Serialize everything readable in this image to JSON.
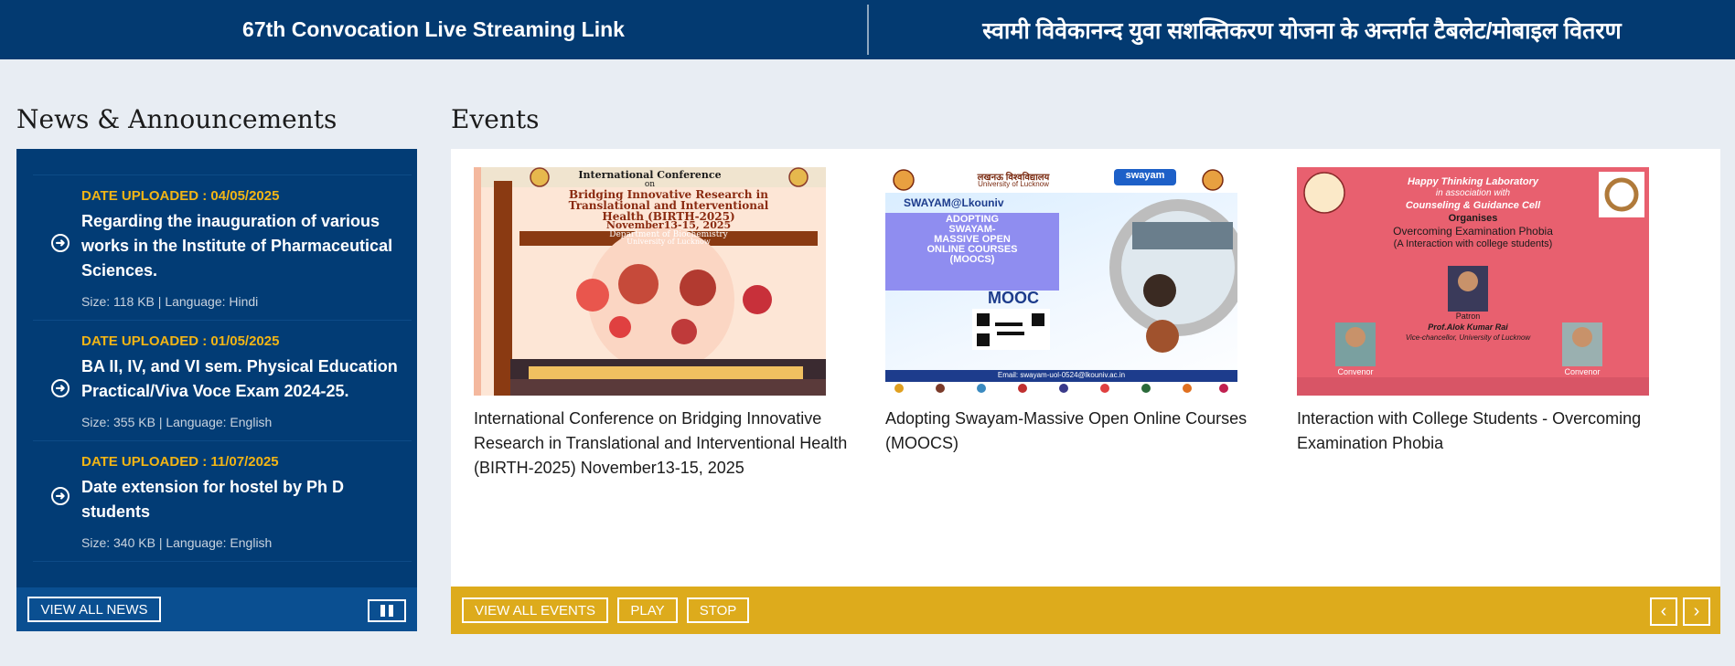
{
  "topbar": {
    "left_link": "67th Convocation Live Streaming Link",
    "right_link": "स्वामी विवेकानन्द युवा सशक्तिकरण योजना के अन्तर्गत टैबलेट/मोबाइल वितरण"
  },
  "news": {
    "heading": "News & Announcements",
    "items": [
      {
        "date": "DATE UPLOADED : 04/05/2025",
        "title": "Regarding the inauguration of various works in the Institute of Pharmaceutical Sciences.",
        "meta": "Size: 118 KB | Language: Hindi"
      },
      {
        "date": "DATE UPLOADED : 01/05/2025",
        "title": "BA II, IV, and VI sem. Physical Education Practical/Viva Voce Exam 2024-25.",
        "meta": "Size: 355 KB | Language: English"
      },
      {
        "date": "DATE UPLOADED : 11/07/2025",
        "title": "Date extension for hostel by Ph D students",
        "meta": "Size: 340 KB | Language: English"
      }
    ],
    "view_all": "VIEW ALL NEWS",
    "item_icon": "circle-arrow-right-icon",
    "pause_icon": "pause-icon"
  },
  "events": {
    "heading": "Events",
    "cards": [
      {
        "title": "International Conference on Bridging Innovative Research in Translational and Interventional Health (BIRTH-2025) November13-15, 2025",
        "poster": {
          "header": "International Conference",
          "on": "on",
          "line1": "Bridging Innovative Research in",
          "line2": "Translational and Interventional",
          "line3": "Health (BIRTH-2025)",
          "line4": "November13-15, 2025",
          "dept1": "Department of Biochemistry",
          "dept2": "University of Lucknow"
        }
      },
      {
        "title": "Adopting Swayam-Massive Open Online Courses (MOOCS)",
        "poster": {
          "uni_hi": "लखनऊ विश्वविद्यालय",
          "uni_en": "University of Lucknow",
          "swayam": "swayam",
          "handle": "SWAYAM@Lkouniv",
          "head1": "ADOPTING",
          "head2": "SWAYAM-",
          "head3": "MASSIVE OPEN",
          "head4": "ONLINE COURSES",
          "head5": "(MOOCS)",
          "mooc": "MOOC",
          "email": "Email: swayam-uol-0524@lkouniv.ac.in"
        }
      },
      {
        "title": "Interaction with College Students - Overcoming Examination Phobia",
        "poster": {
          "lab": "Happy Thinking Laboratory",
          "assoc": "in association with",
          "cell": "Counseling & Guidance Cell",
          "org": "Organises",
          "topic": "Overcoming Examination Phobia",
          "sub": "(A Interaction with college students)",
          "patron": "Patron",
          "patron_name": "Prof.Alok Kumar Rai",
          "patron_role": "Vice-chancellor, University of Lucknow",
          "convenor": "Convenor",
          "convenor2": "Convenor"
        }
      }
    ],
    "buttons": {
      "view_all": "VIEW ALL EVENTS",
      "play": "PLAY",
      "stop": "STOP",
      "prev": "‹",
      "next": "›"
    }
  },
  "colors": {
    "navy": "#033a71",
    "gold": "#ddab1c",
    "date_yellow": "#f2b515"
  }
}
